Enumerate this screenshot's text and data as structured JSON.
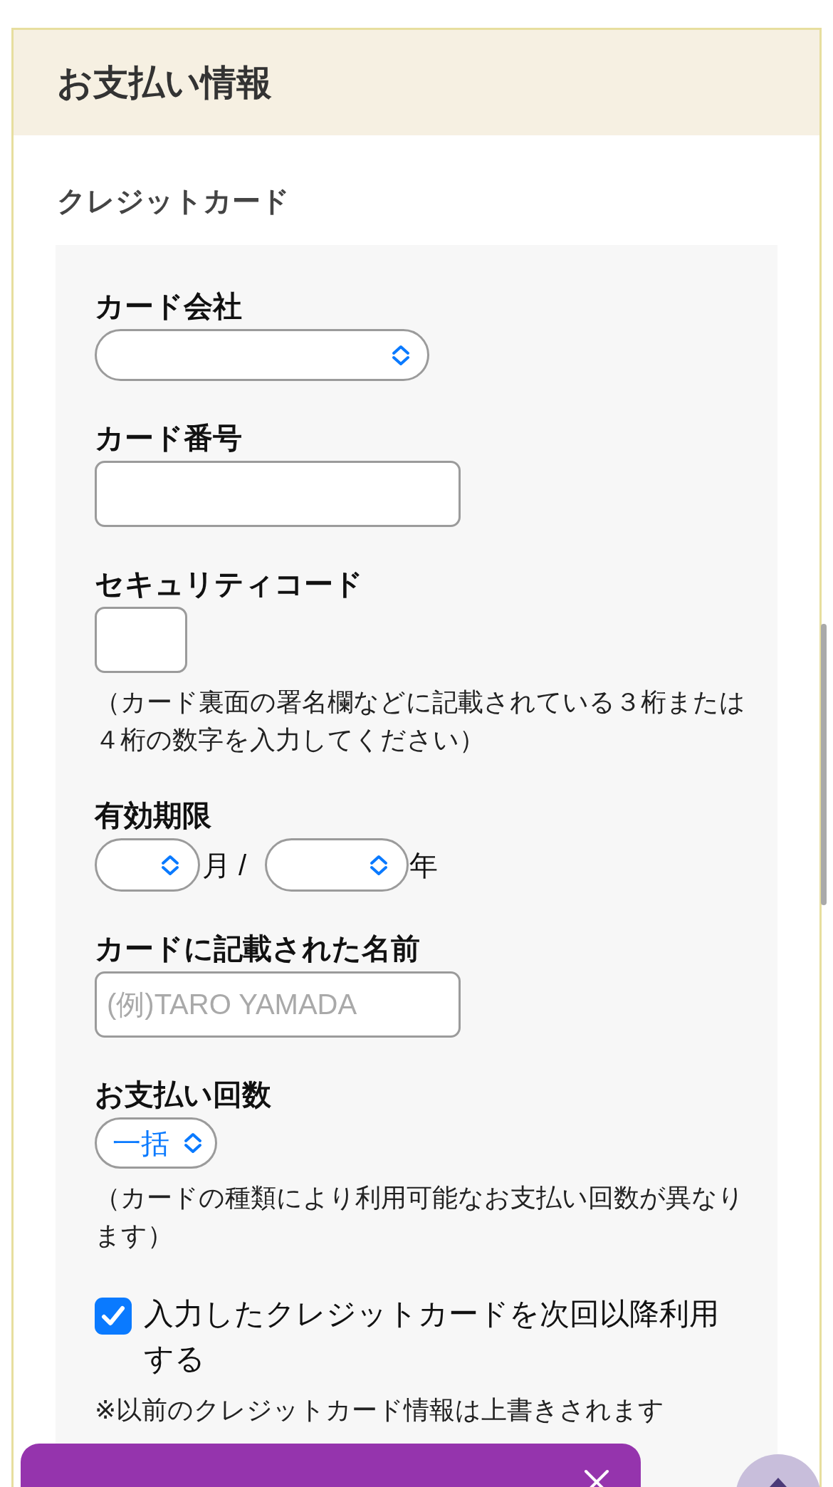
{
  "section": {
    "title": "お支払い情報"
  },
  "method": {
    "title": "クレジットカード"
  },
  "fields": [
    {
      "kind": "select",
      "label": "カード会社"
    },
    {
      "kind": "text",
      "label": "カード番号"
    },
    {
      "kind": "code",
      "label": "セキュリティコード",
      "note": "（カード裏面の署名欄などに記載されている３桁または４桁の数字を入力してください）"
    },
    {
      "kind": "expiry",
      "label": "有効期限",
      "month_unit": "月 /",
      "year_unit": "年"
    },
    {
      "kind": "text",
      "label": "カードに記載された名前",
      "placeholder": "(例)TARO YAMADA"
    },
    {
      "kind": "picker",
      "label": "お支払い回数",
      "value": "一括",
      "note": "（カードの種類により利用可能なお支払い回数が異なります）"
    }
  ],
  "save_card": {
    "label": "入力したクレジットカードを次回以降利用する",
    "checked": true,
    "note": "※以前のクレジットカード情報は上書きされます"
  }
}
